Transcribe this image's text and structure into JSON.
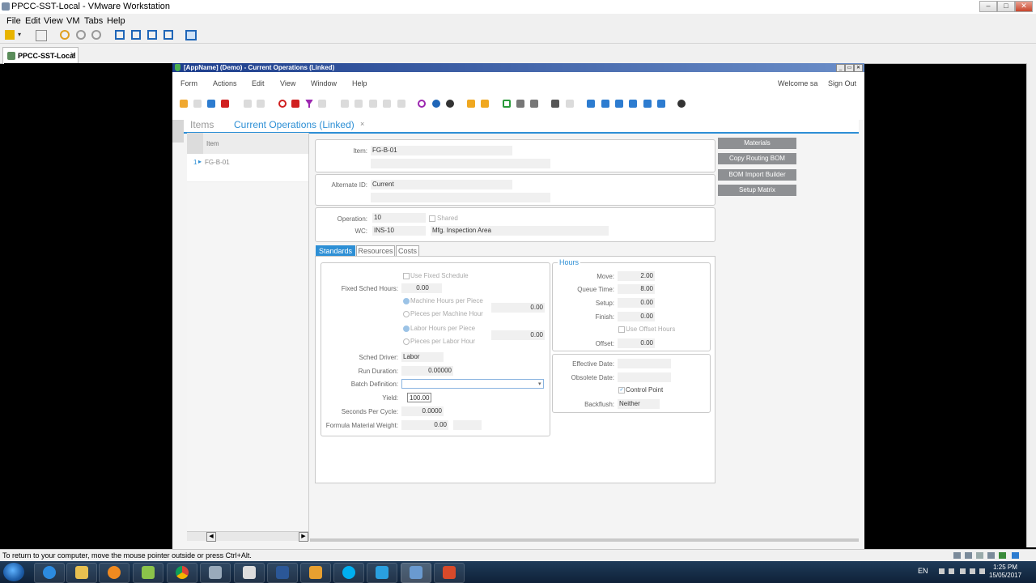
{
  "vm": {
    "title": "PPCC-SST-Local - VMware Workstation",
    "window_buttons": [
      "–",
      "□",
      "✕"
    ],
    "menu": [
      "File",
      "Edit",
      "View",
      "VM",
      "Tabs",
      "Help"
    ],
    "tab_label": "PPCC-SST-Local",
    "tab_close": "✕",
    "status_text": "To return to your computer, move the mouse pointer outside or press Ctrl+Alt."
  },
  "app": {
    "title": "[AppName] (Demo) - Current Operations (Linked)",
    "window_buttons": [
      "_",
      "▭",
      "✕"
    ],
    "menu": [
      "Form",
      "Actions",
      "Edit",
      "View",
      "Window",
      "Help"
    ],
    "welcome": "Welcome sa",
    "sign_out": "Sign Out",
    "tabs": {
      "items": "Items",
      "current": "Current Operations (Linked)",
      "close": "×"
    },
    "grid": {
      "column": "Item",
      "row_number": "1",
      "row_arrow": "▸",
      "row_value": "FG-B-01"
    },
    "scroll_left": "◀",
    "scroll_right": "▶"
  },
  "form": {
    "item_label": "Item:",
    "item_value": "FG-B-01",
    "alternate_label": "Alternate ID:",
    "alternate_value": "Current",
    "operation_label": "Operation:",
    "operation_value": "10",
    "shared_label": "Shared",
    "wc_label": "WC:",
    "wc_value": "INS-10",
    "wc_desc": "Mfg. Inspection Area",
    "buttons": [
      "Materials",
      "Copy Routing BOM",
      "BOM Import Builder",
      "Setup Matrix"
    ],
    "tabs": [
      "Standards",
      "Resources",
      "Costs"
    ],
    "standards": {
      "use_fixed_schedule": "Use Fixed Schedule",
      "fixed_sched_label": "Fixed Sched Hours:",
      "fixed_sched_value": "0.00",
      "machine_hours_per_piece": "Machine Hours per Piece",
      "pieces_per_machine_hour": "Pieces per Machine Hour",
      "machine_value": "0.00",
      "labor_hours_per_piece": "Labor Hours per Piece",
      "pieces_per_labor_hour": "Pieces per Labor Hour",
      "labor_value": "0.00",
      "sched_driver_label": "Sched Driver:",
      "sched_driver_value": "Labor",
      "run_duration_label": "Run Duration:",
      "run_duration_value": "0.00000",
      "batch_definition_label": "Batch Definition:",
      "batch_definition_value": "",
      "yield_label": "Yield:",
      "yield_value": "100.00",
      "seconds_per_cycle_label": "Seconds Per Cycle:",
      "seconds_per_cycle_value": "0.0000",
      "formula_weight_label": "Formula Material Weight:",
      "formula_weight_value": "0.00"
    },
    "hours": {
      "title": "Hours",
      "move_label": "Move:",
      "move_value": "2.00",
      "queue_label": "Queue Time:",
      "queue_value": "8.00",
      "setup_label": "Setup:",
      "setup_value": "0.00",
      "finish_label": "Finish:",
      "finish_value": "0.00",
      "use_offset_label": "Use Offset Hours",
      "offset_label": "Offset:",
      "offset_value": "0.00"
    },
    "dates": {
      "effective_label": "Effective Date:",
      "effective_value": "",
      "obsolete_label": "Obsolete Date:",
      "obsolete_value": "",
      "control_point_label": "Control Point",
      "backflush_label": "Backflush:",
      "backflush_value": "Neither"
    }
  },
  "taskbar": {
    "lang": "EN",
    "time": "1:25 PM",
    "date": "15/05/2017"
  }
}
